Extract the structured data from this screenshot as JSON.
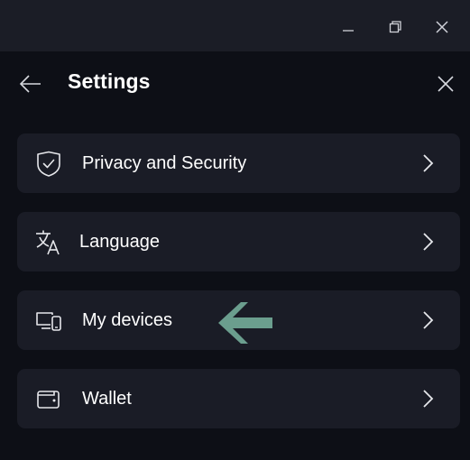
{
  "window": {
    "minimize_icon": "minimize-icon",
    "restore_icon": "restore-icon",
    "close_icon": "close-icon"
  },
  "header": {
    "title": "Settings",
    "back_icon": "arrow-left-icon",
    "close_icon": "close-icon"
  },
  "menu": {
    "items": [
      {
        "label": "Privacy and Security",
        "icon": "shield-icon"
      },
      {
        "label": "Language",
        "icon": "translate-icon"
      },
      {
        "label": "My devices",
        "icon": "devices-icon"
      },
      {
        "label": "Wallet",
        "icon": "wallet-icon"
      }
    ]
  },
  "annotation": {
    "icon": "arrow-left-pointer",
    "color": "#6b9e8e"
  },
  "colors": {
    "background": "#0d0f16",
    "titlebar": "#1b1d26",
    "card": "#1a1c26",
    "text": "#ffffff"
  }
}
